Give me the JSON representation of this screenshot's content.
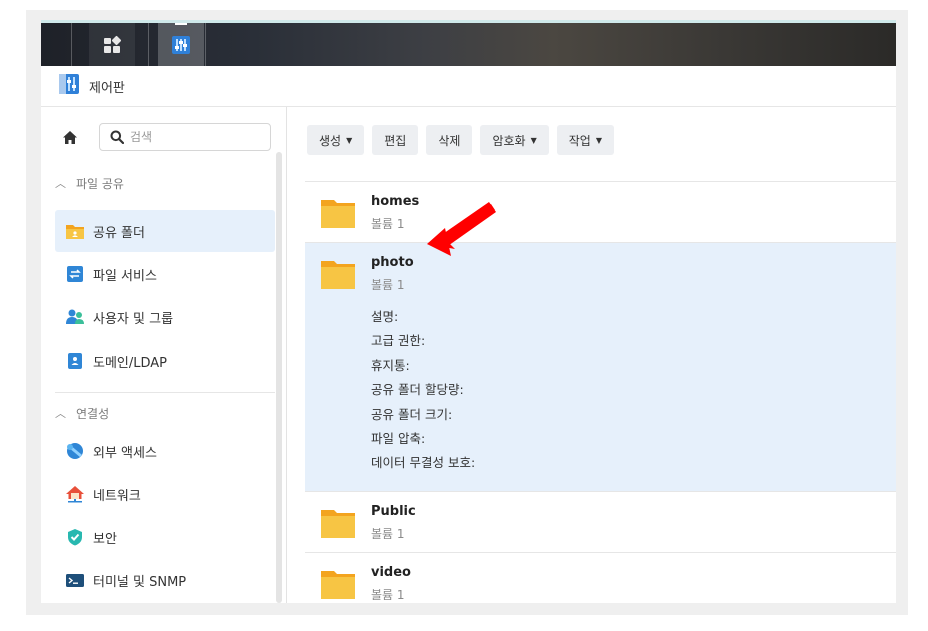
{
  "window": {
    "title": "제어판"
  },
  "sidebar": {
    "search_placeholder": "검색",
    "sections": [
      {
        "label": "파일 공유",
        "items": [
          {
            "label": "공유 폴더",
            "icon": "shared-folder-icon",
            "active": true
          },
          {
            "label": "파일 서비스",
            "icon": "file-services-icon"
          },
          {
            "label": "사용자 및 그룹",
            "icon": "user-group-icon"
          },
          {
            "label": "도메인/LDAP",
            "icon": "domain-ldap-icon"
          }
        ]
      },
      {
        "label": "연결성",
        "items": [
          {
            "label": "외부 액세스",
            "icon": "external-access-icon"
          },
          {
            "label": "네트워크",
            "icon": "network-icon"
          },
          {
            "label": "보안",
            "icon": "shield-icon"
          },
          {
            "label": "터미널 및 SNMP",
            "icon": "terminal-icon"
          }
        ]
      }
    ]
  },
  "toolbar": {
    "create": "생성",
    "edit": "편집",
    "delete": "삭제",
    "encryption": "암호화",
    "action": "작업"
  },
  "folders": [
    {
      "name": "homes",
      "volume": "볼륨 1"
    },
    {
      "name": "photo",
      "volume": "볼륨 1",
      "selected": true,
      "details": [
        "설명:",
        "고급 권한:",
        "휴지통:",
        "공유 폴더 할당량:",
        "공유 폴더 크기:",
        "파일 압축:",
        "데이터 무결성 보호:"
      ]
    },
    {
      "name": "Public",
      "volume": "볼륨 1"
    },
    {
      "name": "video",
      "volume": "볼륨 1"
    }
  ],
  "colors": {
    "accent": "#e6f0fb",
    "folder": "#f7c544",
    "arrow": "#ff0000"
  }
}
